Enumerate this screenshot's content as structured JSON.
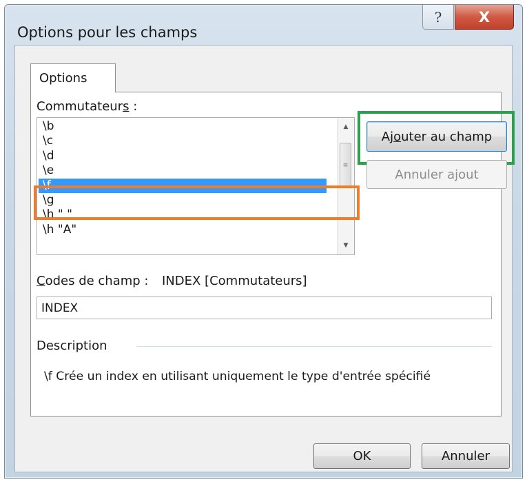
{
  "window": {
    "title": "Options pour les champs",
    "help_glyph": "?",
    "close_glyph": "X"
  },
  "tabs": [
    {
      "label": "Options",
      "selected": true
    }
  ],
  "switches": {
    "label_prefix": "Commutateur",
    "label_mnemonic": "s",
    "label_suffix": " :",
    "items": [
      "\\b",
      "\\c",
      "\\d",
      "\\e",
      "\\f",
      "\\g",
      "\\h \" \"",
      "\\h \"A\""
    ],
    "selected_index": 4
  },
  "buttons": {
    "add_label_pre": "Aj",
    "add_label_mnemonic": "o",
    "add_label_post": "uter au champ",
    "undo_label": "Annuler ajout",
    "ok_label": "OK",
    "cancel_label": "Annuler"
  },
  "field_codes": {
    "label_mnemonic": "C",
    "label_rest": "odes de champ :",
    "syntax": "INDEX [Commutateurs]",
    "value": "INDEX"
  },
  "description": {
    "heading": "Description",
    "text": "\\f Crée un index en utilisant uniquement le type d'entrée spécifié"
  },
  "colors": {
    "selection": "#3399ff",
    "highlight_add_button": "#2aa24a",
    "highlight_selected_item": "#ee7d2b",
    "close_button": "#c0412b"
  }
}
